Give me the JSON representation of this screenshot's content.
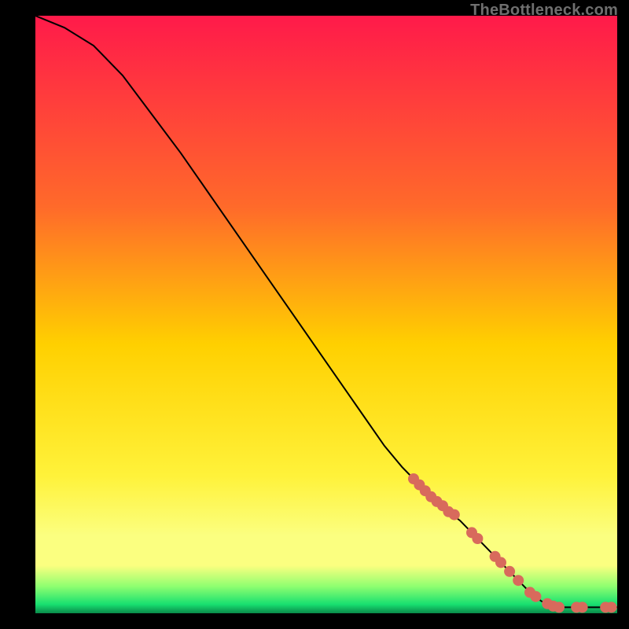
{
  "attribution": "TheBottleneck.com",
  "colors": {
    "top": "#ff1a4a",
    "mid1": "#ff6a2a",
    "mid2": "#ffd000",
    "mid3": "#fff23a",
    "band": "#fbff80",
    "green1": "#8fff70",
    "green2": "#18e070",
    "marker": "#d86a5c",
    "line": "#000000",
    "outside": "#000000"
  },
  "chart_data": {
    "type": "line",
    "title": "",
    "xlabel": "",
    "ylabel": "",
    "xlim": [
      0,
      100
    ],
    "ylim": [
      0,
      100
    ],
    "curve": [
      {
        "x": 0,
        "y": 100
      },
      {
        "x": 5,
        "y": 98
      },
      {
        "x": 10,
        "y": 95
      },
      {
        "x": 15,
        "y": 90
      },
      {
        "x": 20,
        "y": 83.5
      },
      {
        "x": 25,
        "y": 77
      },
      {
        "x": 30,
        "y": 70
      },
      {
        "x": 35,
        "y": 63
      },
      {
        "x": 40,
        "y": 56
      },
      {
        "x": 45,
        "y": 49
      },
      {
        "x": 50,
        "y": 42
      },
      {
        "x": 55,
        "y": 35
      },
      {
        "x": 60,
        "y": 28
      },
      {
        "x": 63,
        "y": 24.5
      },
      {
        "x": 65,
        "y": 22.5
      },
      {
        "x": 67,
        "y": 20.5
      },
      {
        "x": 69,
        "y": 18.5
      },
      {
        "x": 71,
        "y": 17.0
      },
      {
        "x": 73,
        "y": 15.5
      },
      {
        "x": 75,
        "y": 13.5
      },
      {
        "x": 77,
        "y": 11.5
      },
      {
        "x": 79,
        "y": 9.5
      },
      {
        "x": 81,
        "y": 7.5
      },
      {
        "x": 83,
        "y": 5.5
      },
      {
        "x": 85,
        "y": 3.5
      },
      {
        "x": 87,
        "y": 2.0
      },
      {
        "x": 89,
        "y": 1.2
      },
      {
        "x": 91,
        "y": 1.0
      },
      {
        "x": 93,
        "y": 1.0
      },
      {
        "x": 95,
        "y": 1.0
      },
      {
        "x": 97,
        "y": 1.0
      },
      {
        "x": 99,
        "y": 1.0
      },
      {
        "x": 100,
        "y": 1.0
      }
    ],
    "markers": [
      {
        "x": 65,
        "y": 22.5
      },
      {
        "x": 66,
        "y": 21.5
      },
      {
        "x": 67,
        "y": 20.5
      },
      {
        "x": 68,
        "y": 19.5
      },
      {
        "x": 69,
        "y": 18.7
      },
      {
        "x": 70,
        "y": 18.0
      },
      {
        "x": 71,
        "y": 17.0
      },
      {
        "x": 72,
        "y": 16.5
      },
      {
        "x": 75,
        "y": 13.5
      },
      {
        "x": 76,
        "y": 12.5
      },
      {
        "x": 79,
        "y": 9.5
      },
      {
        "x": 80,
        "y": 8.5
      },
      {
        "x": 81.5,
        "y": 7.0
      },
      {
        "x": 83,
        "y": 5.5
      },
      {
        "x": 85,
        "y": 3.5
      },
      {
        "x": 86,
        "y": 2.8
      },
      {
        "x": 88,
        "y": 1.6
      },
      {
        "x": 89,
        "y": 1.2
      },
      {
        "x": 90,
        "y": 1.0
      },
      {
        "x": 93,
        "y": 1.0
      },
      {
        "x": 94,
        "y": 1.0
      },
      {
        "x": 98,
        "y": 1.0
      },
      {
        "x": 99,
        "y": 1.0
      }
    ]
  }
}
